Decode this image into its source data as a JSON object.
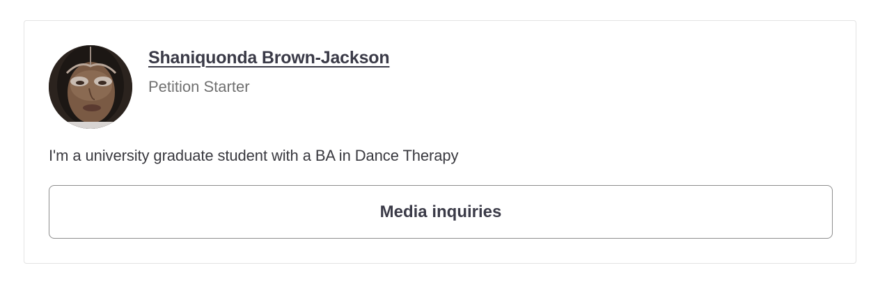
{
  "starter": {
    "name": "Shaniquonda Brown-Jackson",
    "role": "Petition Starter",
    "bio": "I'm a university graduate student with a BA in Dance Therapy",
    "avatar_icon": "user-photo-avatar"
  },
  "actions": {
    "media_label": "Media inquiries"
  },
  "colors": {
    "text_primary": "#3a3a47",
    "text_secondary": "#707070",
    "card_border": "#e3e3e3",
    "button_border": "#8c8c8c"
  }
}
